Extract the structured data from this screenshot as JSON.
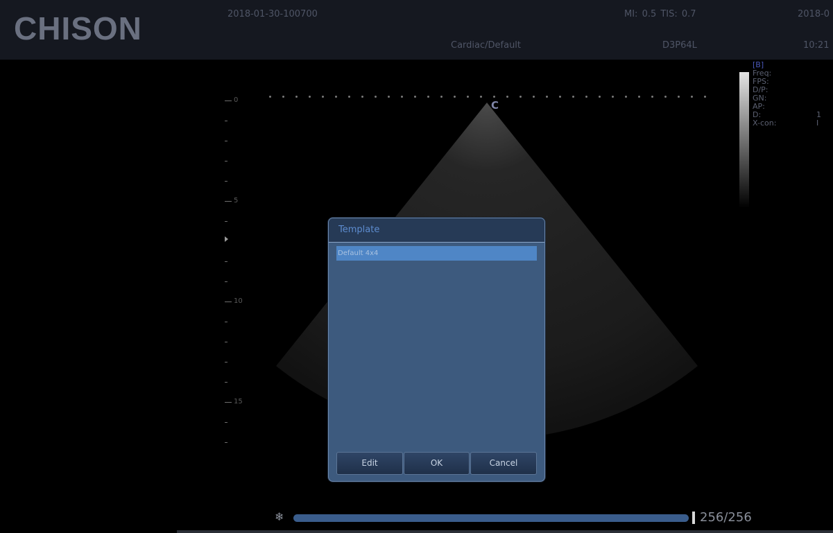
{
  "header": {
    "logo": "CHISON",
    "exam_id": "2018-01-30-100700",
    "preset": "Cardiac/Default",
    "mi_tis": "MI: 0.5  TIS: 0.7",
    "probe": "D3P64L",
    "date_partial": "2018-0",
    "time_partial": "10:21"
  },
  "image": {
    "orientation_marker": "C",
    "depth_labels": [
      "0",
      "5",
      "10",
      "15"
    ]
  },
  "params": {
    "mode": "[B]",
    "rows": [
      {
        "label": "Freq:",
        "value": ""
      },
      {
        "label": "FPS:",
        "value": ""
      },
      {
        "label": "D/P:",
        "value": ""
      },
      {
        "label": "GN:",
        "value": ""
      },
      {
        "label": "AP:",
        "value": ""
      },
      {
        "label": "D:",
        "value": "1"
      },
      {
        "label": "X-con:",
        "value": "I"
      }
    ]
  },
  "dialog": {
    "title": "Template",
    "items": [
      "Default 4x4"
    ],
    "selected_index": 0,
    "buttons": {
      "edit": "Edit",
      "ok": "OK",
      "cancel": "Cancel"
    }
  },
  "cine": {
    "icon": "freeze-snowflake-icon",
    "counter": "256/256",
    "current_frame": 256,
    "total_frames": 256
  },
  "colors": {
    "header_bg": "#151820",
    "dialog_bg": "#3d5a7e",
    "dialog_title_bg": "#263a56",
    "selection": "#4f86c6",
    "cine_bar": "#3a5d8c"
  }
}
